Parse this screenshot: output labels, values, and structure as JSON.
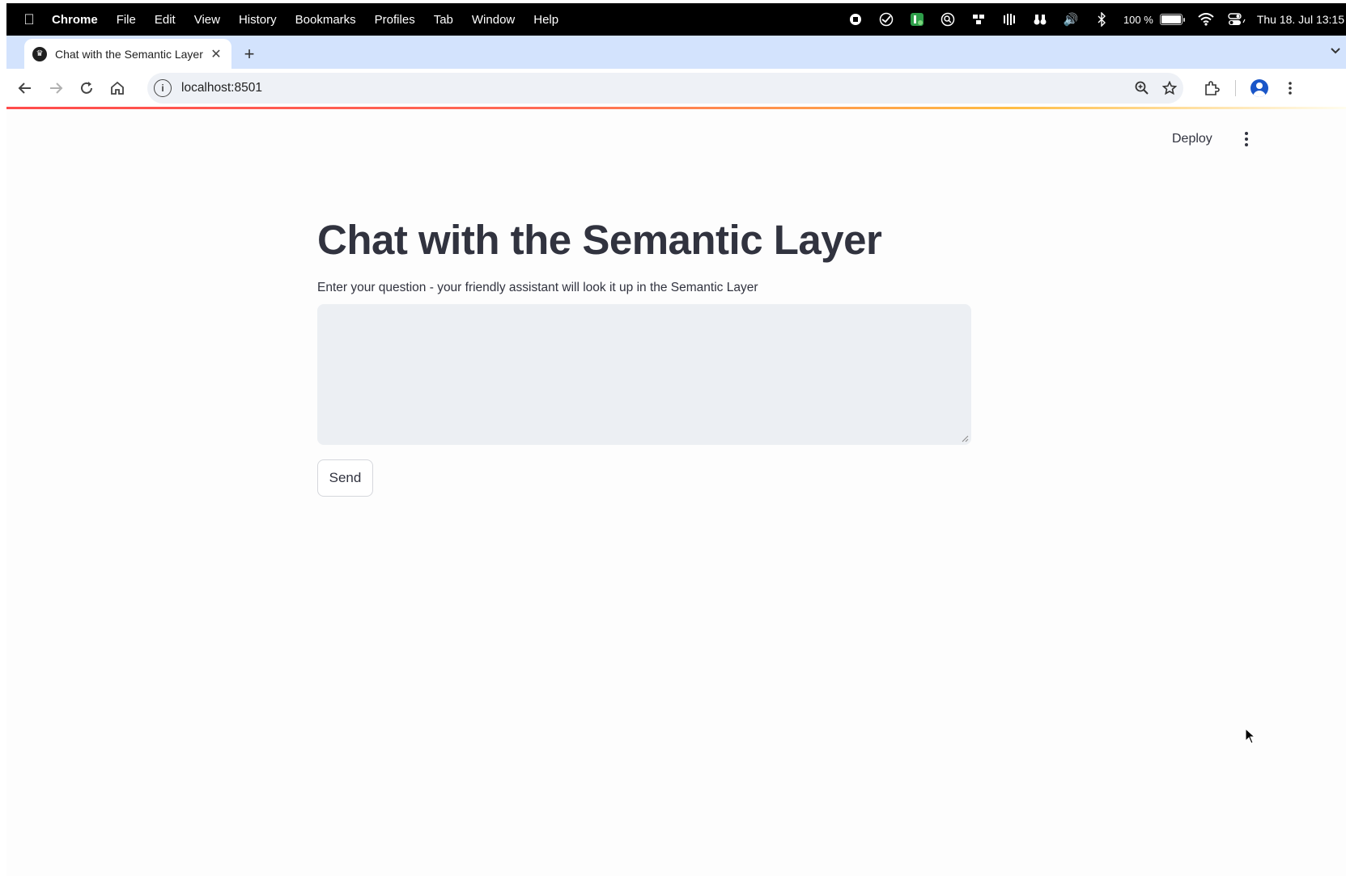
{
  "menubar": {
    "apple_icon": "apple-icon",
    "app_name": "Chrome",
    "items": [
      "File",
      "Edit",
      "View",
      "History",
      "Bookmarks",
      "Profiles",
      "Tab",
      "Window",
      "Help"
    ],
    "battery_text": "100 %",
    "clock": "Thu 18. Jul  13:15"
  },
  "browser": {
    "tab_title": "Chat with the Semantic Layer",
    "url": "localhost:8501"
  },
  "app": {
    "deploy_label": "Deploy",
    "title": "Chat with the Semantic Layer",
    "prompt_label": "Enter your question - your friendly assistant will look it up in the Semantic Layer",
    "question_value": "",
    "send_label": "Send"
  },
  "colors": {
    "accent": "#ff4b4b",
    "text": "#31333f",
    "input_bg": "#eceff3",
    "tabstrip_bg": "#d3e3fd"
  }
}
